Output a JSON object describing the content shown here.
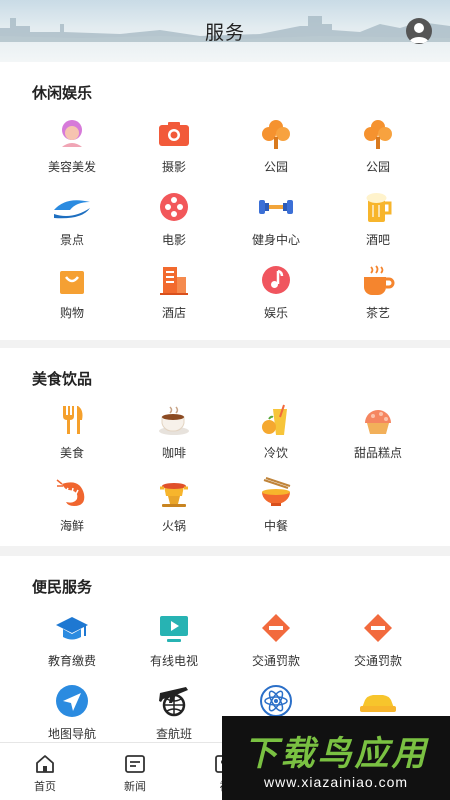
{
  "header": {
    "title": "服务"
  },
  "sections": [
    {
      "title": "休闲娱乐",
      "items": [
        {
          "label": "美容美发",
          "icon": "beauty-salon-icon"
        },
        {
          "label": "摄影",
          "icon": "camera-icon"
        },
        {
          "label": "公园",
          "icon": "tree-icon"
        },
        {
          "label": "公园",
          "icon": "tree-icon"
        },
        {
          "label": "景点",
          "icon": "wave-icon"
        },
        {
          "label": "电影",
          "icon": "film-reel-icon"
        },
        {
          "label": "健身中心",
          "icon": "dumbbell-icon"
        },
        {
          "label": "酒吧",
          "icon": "beer-icon"
        },
        {
          "label": "购物",
          "icon": "shopping-bag-icon"
        },
        {
          "label": "酒店",
          "icon": "hotel-building-icon"
        },
        {
          "label": "娱乐",
          "icon": "music-note-icon"
        },
        {
          "label": "茶艺",
          "icon": "tea-cup-icon"
        }
      ]
    },
    {
      "title": "美食饮品",
      "items": [
        {
          "label": "美食",
          "icon": "fork-knife-icon"
        },
        {
          "label": "咖啡",
          "icon": "coffee-cup-icon"
        },
        {
          "label": "冷饮",
          "icon": "cold-drink-icon"
        },
        {
          "label": "甜品糕点",
          "icon": "cake-icon"
        },
        {
          "label": "海鲜",
          "icon": "shrimp-icon"
        },
        {
          "label": "火锅",
          "icon": "hotpot-icon"
        },
        {
          "label": "中餐",
          "icon": "noodle-bowl-icon"
        }
      ]
    },
    {
      "title": "便民服务",
      "items": [
        {
          "label": "教育缴费",
          "icon": "graduation-cap-icon"
        },
        {
          "label": "有线电视",
          "icon": "tv-icon"
        },
        {
          "label": "交通罚款",
          "icon": "no-entry-icon"
        },
        {
          "label": "交通罚款",
          "icon": "no-entry-icon"
        },
        {
          "label": "地图导航",
          "icon": "navigation-arrow-icon"
        },
        {
          "label": "查航班",
          "icon": "airplane-globe-icon"
        },
        {
          "label": "",
          "icon": "atom-icon"
        },
        {
          "label": "",
          "icon": "car-icon"
        }
      ]
    }
  ],
  "tabbar": [
    {
      "label": "首页",
      "icon": "home-icon"
    },
    {
      "label": "新闻",
      "icon": "news-icon"
    },
    {
      "label": "视",
      "icon": "video-icon"
    }
  ],
  "watermark": {
    "title": "下载鸟应用",
    "url": "www.xiazainiao.com"
  },
  "colors": {
    "accent_orange": "#f26a3d",
    "accent_blue": "#2b8be0",
    "accent_teal": "#27b3b3",
    "text": "#333333",
    "background": "#f2f2f2"
  }
}
